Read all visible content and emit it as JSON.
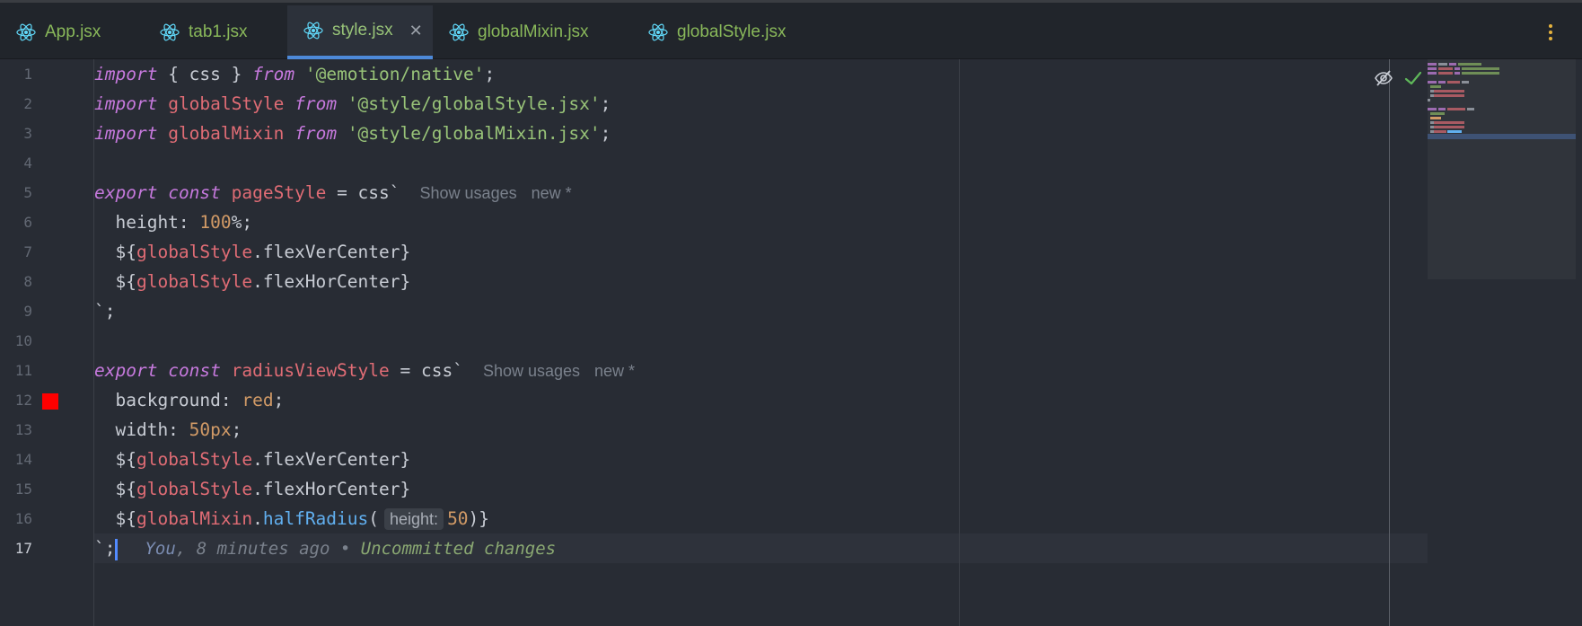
{
  "tabs": [
    {
      "label": "App.jsx",
      "active": false
    },
    {
      "label": "tab1.jsx",
      "active": false
    },
    {
      "label": "style.jsx",
      "active": true
    },
    {
      "label": "globalMixin.jsx",
      "active": false
    },
    {
      "label": "globalStyle.jsx",
      "active": false
    }
  ],
  "close_glyph": "✕",
  "line_numbers": [
    "1",
    "2",
    "3",
    "4",
    "5",
    "6",
    "7",
    "8",
    "9",
    "10",
    "11",
    "12",
    "13",
    "14",
    "15",
    "16",
    "17"
  ],
  "current_line": 17,
  "code": {
    "l1": {
      "kw1": "import",
      "t1": " { css } ",
      "kw2": "from",
      "t2": " ",
      "str": "'@emotion/native'",
      "t3": ";"
    },
    "l2": {
      "kw1": "import",
      "t1": " ",
      "var": "globalStyle",
      "t2": " ",
      "kw2": "from",
      "t3": " ",
      "str": "'@style/globalStyle.jsx'",
      "t4": ";"
    },
    "l3": {
      "kw1": "import",
      "t1": " ",
      "var": "globalMixin",
      "t2": " ",
      "kw2": "from",
      "t3": " ",
      "str": "'@style/globalMixin.jsx'",
      "t4": ";"
    },
    "l5": {
      "kw1": "export",
      "t1": " ",
      "kw2": "const",
      "t2": " ",
      "var": "pageStyle",
      "t3": " = css`",
      "hint1": "Show usages",
      "hint2": "new *"
    },
    "l6": {
      "t1": "  height: ",
      "num": "100",
      "t2": "%;"
    },
    "l7": {
      "t1": "  ${",
      "var": "globalStyle",
      "t2": ".flexVerCenter}"
    },
    "l8": {
      "t1": "  ${",
      "var": "globalStyle",
      "t2": ".flexHorCenter}"
    },
    "l9": {
      "t1": "`;"
    },
    "l11": {
      "kw1": "export",
      "t1": " ",
      "kw2": "const",
      "t2": " ",
      "var": "radiusViewStyle",
      "t3": " = css`",
      "hint1": "Show usages",
      "hint2": "new *"
    },
    "l12": {
      "t1": "  background: ",
      "num": "red",
      "t2": ";"
    },
    "l13": {
      "t1": "  width: ",
      "num": "50px",
      "t2": ";"
    },
    "l14": {
      "t1": "  ${",
      "var": "globalStyle",
      "t2": ".flexVerCenter}"
    },
    "l15": {
      "t1": "  ${",
      "var": "globalStyle",
      "t2": ".flexHorCenter}"
    },
    "l16": {
      "t1": "  ${",
      "var": "globalMixin",
      "t2": ".",
      "fn": "halfRadius",
      "t3": "(",
      "param": "height:",
      "num": "50",
      "t4": ")}"
    },
    "l17": {
      "t1": "`;",
      "blame_you": "You",
      "blame_rest": ", 8 minutes ago",
      "blame_sep": " • ",
      "blame_msg": "Uncommitted changes"
    }
  },
  "colors": {
    "swatch": "#ff0000",
    "accent": "#4d89d8",
    "check": "#5fb85a",
    "more": "#e6b33e"
  },
  "icons": {
    "tab": "react-icon",
    "inspection_hidden": "eye-slash-icon",
    "inspection_ok": "checkmark-icon",
    "more": "more-vertical-icon"
  }
}
